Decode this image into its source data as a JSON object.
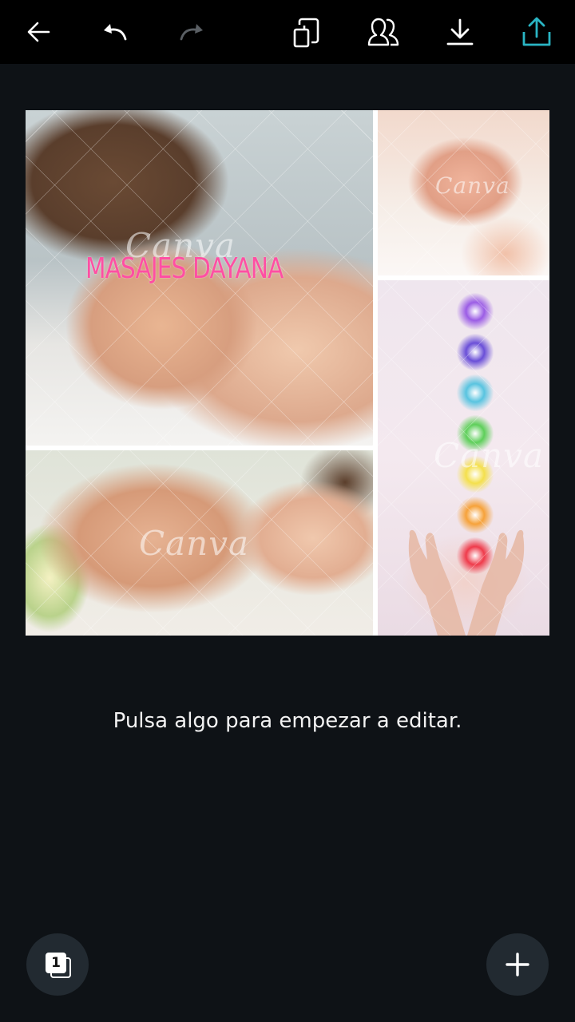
{
  "toolbar": {
    "back_icon": "arrow-left-icon",
    "undo_icon": "undo-icon",
    "redo_icon": "redo-icon",
    "pages_icon": "copy-pages-icon",
    "share_people_icon": "people-icon",
    "download_icon": "download-icon",
    "share_icon": "share-upload-icon",
    "share_color": "#2ab5c4"
  },
  "design": {
    "title": "MASAJES DAYANA",
    "title_color": "#ff4fa3",
    "watermarks": [
      "Canva",
      "Canva",
      "Canva",
      "Canva"
    ],
    "photos": [
      {
        "name": "woman-on-massage-table"
      },
      {
        "name": "foot-massage"
      },
      {
        "name": "hot-stone-massage"
      },
      {
        "name": "chakra-hands"
      }
    ],
    "chakra_colors": [
      "#9b5de5",
      "#6a4fd8",
      "#59c4e0",
      "#5ecf5a",
      "#f4e04d",
      "#f6a23a",
      "#ef3b4b"
    ]
  },
  "hint": "Pulsa algo para empezar a editar.",
  "pages_button": {
    "count": "1"
  },
  "add_button": {
    "icon": "plus-icon"
  }
}
